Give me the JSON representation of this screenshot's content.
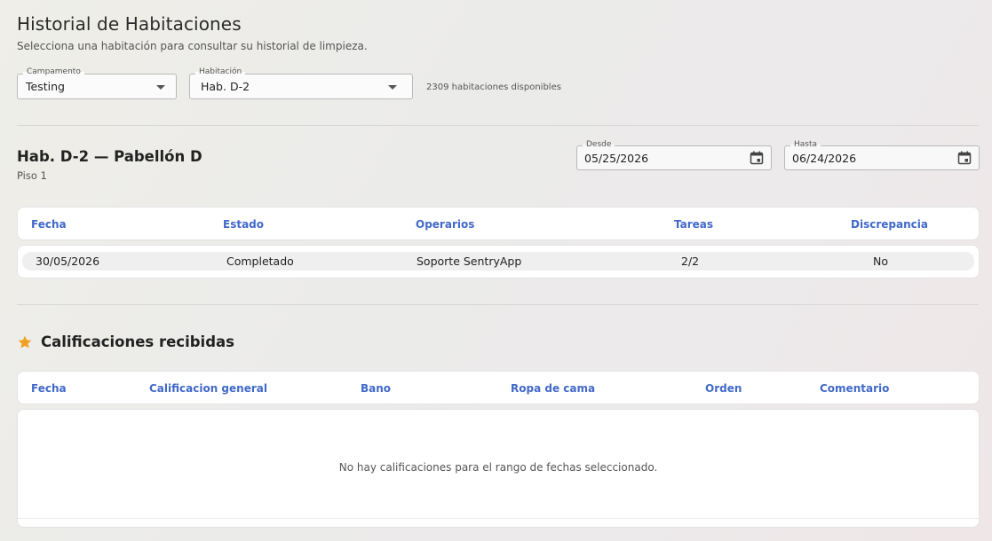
{
  "header": {
    "title": "Historial de Habitaciones",
    "subtitle": "Selecciona una habitación para consultar su historial de limpieza."
  },
  "filters": {
    "campamento": {
      "label": "Campamento",
      "value": "Testing"
    },
    "habitacion": {
      "label": "Habitación",
      "value": "Hab. D-2"
    },
    "available_text": "2309 habitaciones disponibles"
  },
  "room": {
    "title": "Hab. D-2 — Pabellón D",
    "floor": "Piso 1"
  },
  "date_range": {
    "desde": {
      "label": "Desde",
      "value": "05/25/2026"
    },
    "hasta": {
      "label": "Hasta",
      "value": "06/24/2026"
    }
  },
  "history_table": {
    "columns": [
      "Fecha",
      "Estado",
      "Operarios",
      "Tareas",
      "Discrepancia"
    ],
    "rows": [
      {
        "fecha": "30/05/2026",
        "estado": "Completado",
        "operarios": "Soporte SentryApp",
        "tareas": "2/2",
        "discrepancia": "No"
      }
    ]
  },
  "ratings": {
    "title": "Calificaciones recibidas",
    "columns": [
      "Fecha",
      "Calificacion general",
      "Bano",
      "Ropa de cama",
      "Orden",
      "Comentario"
    ],
    "empty_message": "No hay calificaciones para el rango de fechas seleccionado."
  },
  "colors": {
    "accent": "#4169c9",
    "star": "#f0a020"
  }
}
